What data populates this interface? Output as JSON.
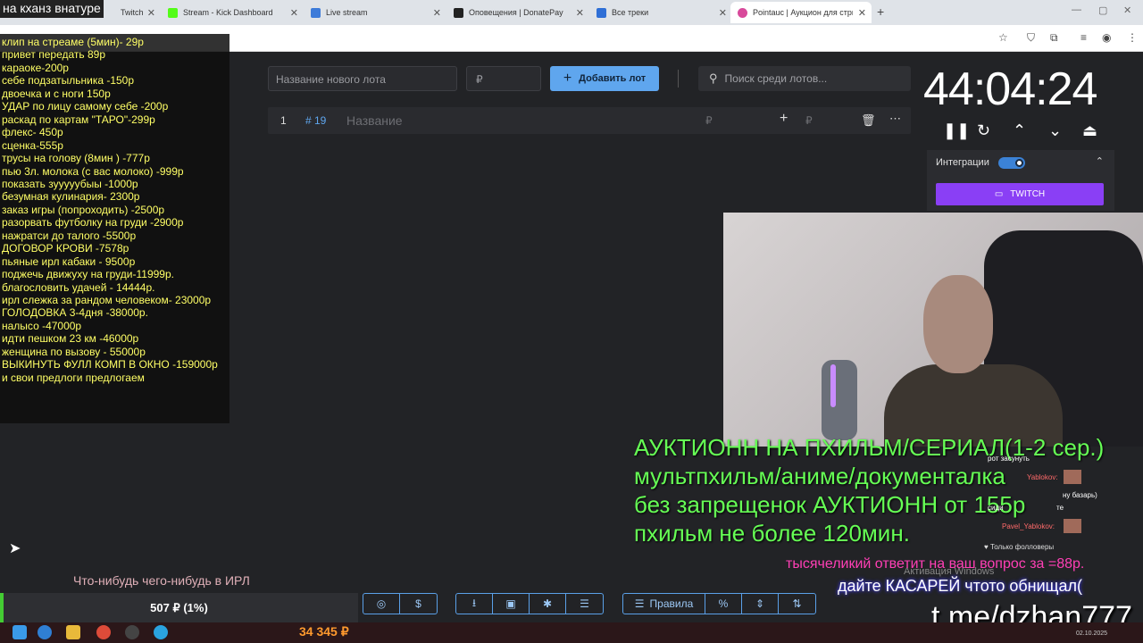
{
  "browser": {
    "tabs": [
      {
        "label": "Twitch",
        "color": "#9146ff"
      },
      {
        "label": "Stream - Kick Dashboard",
        "color": "#53fc18"
      },
      {
        "label": "Live stream",
        "color": "#3d7bd9"
      },
      {
        "label": "Оповещения | DonatePay",
        "color": "#222222"
      },
      {
        "label": "Все треки",
        "color": "#2f6fd6"
      },
      {
        "label": "Pointauc | Аукцион для стрима",
        "color": "#d84a9b"
      }
    ],
    "new_tab_symbol": "+"
  },
  "auction": {
    "new_lot_placeholder": "Название нового лота",
    "currency_placeholder": "₽",
    "add_lot_label": "Добавить лот",
    "search_placeholder": "Поиск среди лотов...",
    "lot_row": {
      "index": "1",
      "id": "# 19",
      "name_placeholder": "Название",
      "amount_placeholder": "₽",
      "add_amount_placeholder": "₽"
    }
  },
  "timer": {
    "value": "44:04:24"
  },
  "integrations": {
    "label": "Интеграции",
    "toggle_on": true,
    "twitch_label": "TWITCH"
  },
  "overlay_list": {
    "title": "на кханз внатуре",
    "items": [
      "клип на стреаме (5мин)- 29р",
      "привет передать 89р",
      "караоке-200р",
      "себе подзатыльника -150р",
      "двоечка и с ноги 150р",
      "УДАР по лицу самому себе -200р",
      "раскад по картам \"ТАРО\"-299р",
      "флекс- 450р",
      "сценка-555р",
      "трусы на голову (8мин ) -777р",
      "пью 3л. молока (с вас молоко) -999р",
      "показать зууууубыы -1000р",
      "безумная кулинария- 2300р",
      "заказ игры (попроходить) -2500р",
      "разорвать футболку на груди -2900р",
      "нажратси до талого -5500р",
      "ДОГОВОР КРОВИ -7578р",
      "пьяные ирл кабаки - 9500р",
      "поджечь движуху на груди-11999р.",
      "благословить удачей - 14444р.",
      "ирл слежка за рандом человеком- 23000р",
      "ГОЛОДОВКА 3-4дня -38000р.",
      "налысо -47000р",
      "идти пешком 23 км -46000р",
      "женщина по вызову - 55000р",
      "ВЫКИНУТЬ ФУЛЛ КОМП В ОКНО -159000р",
      "и свои предлоги предлогаем"
    ]
  },
  "stream_overlay": {
    "auction_lines": [
      "АУКТИОНН НА ПХИЛЬМ/СЕРИАЛ(1-2 сер.)",
      "мультпхильм/аниме/документалка",
      "без запрещенок АУКТИОНН от 155р",
      "пхильм не более 120мин."
    ],
    "chat": {
      "lines": [
        "рот засунуть",
        "Yablokov:",
        "ну базарь)",
        "сиди",
        "те",
        "Pavel_Yablokov:"
      ],
      "followers_only": "Только фолловеры"
    },
    "question_text": "тысячеликий ответит на ваш вопрос за =88р.",
    "activation_text": "Активация Windows",
    "kasarei_text": "дайте КАСАРЕЙ чтото обнищал(",
    "telegram_link": "t.me/dzhan777",
    "irl_text": "Что-нибудь чего-нибудь в ИРЛ"
  },
  "progress": {
    "label": "507 ₽ (1%)",
    "fraction": 0.01
  },
  "toolbar": {
    "rules_label": "Правила"
  },
  "taskbar": {
    "money": "34 345 ₽",
    "date": "02.10.2025"
  }
}
